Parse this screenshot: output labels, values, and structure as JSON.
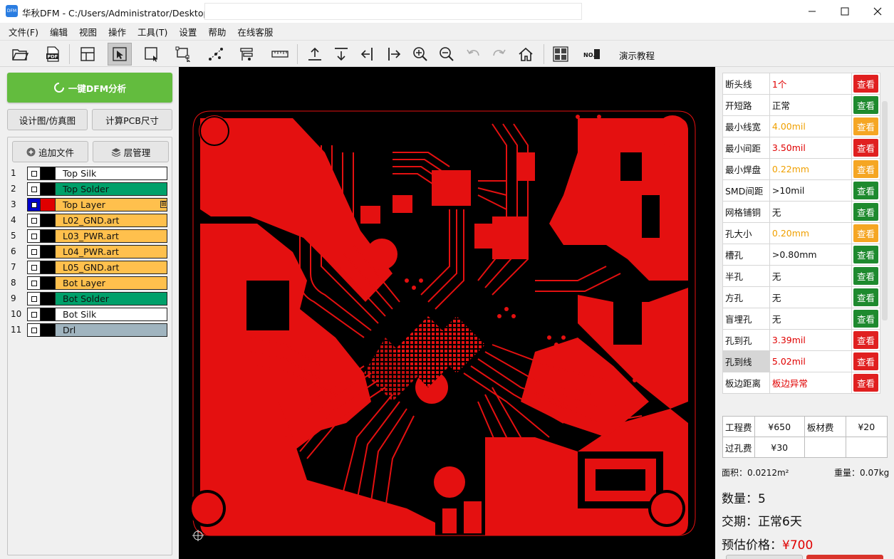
{
  "window": {
    "icon_text": "DFM",
    "title": "华秋DFM - C:/Users/Administrator/Desktop/(",
    "minimize_icon": "minimize-icon",
    "maximize_icon": "maximize-icon",
    "close_icon": "close-icon"
  },
  "menu": [
    "文件(F)",
    "编辑",
    "视图",
    "操作",
    "工具(T)",
    "设置",
    "帮助",
    "在线客服"
  ],
  "toolbar": {
    "icons": [
      "open-folder-icon",
      "pdf-icon",
      "window-icon",
      "select-pointer-icon",
      "select-box-icon",
      "net-select-icon",
      "route-icon",
      "align-icon",
      "ruler-icon",
      "export-up-icon",
      "import-down-icon",
      "align-left-icon",
      "align-right-icon",
      "zoom-in-icon",
      "zoom-out-icon",
      "undo-icon",
      "redo-icon",
      "home-icon",
      "panelize-icon",
      "no-serial-icon"
    ],
    "demo_label": "演示教程",
    "pdf_text": "PDF",
    "no_text": "NO."
  },
  "left": {
    "dfm_button": "一键DFM分析",
    "design_button": "设计图/仿真图",
    "pcb_size_button": "计算PCB尺寸",
    "add_file_button": "追加文件",
    "layer_mgmt_button": "层管理",
    "layers": [
      {
        "num": "1",
        "name": "Top Silk",
        "color": "#ffffff",
        "swatch": "#000000"
      },
      {
        "num": "2",
        "name": "Top Solder",
        "color": "#00a06a",
        "swatch": "#000000"
      },
      {
        "num": "3",
        "name": "Top Layer",
        "color": "#ffc04d",
        "swatch": "#e00000",
        "checked_color": "#0000cc",
        "expand": "⊞"
      },
      {
        "num": "4",
        "name": "L02_GND.art",
        "color": "#ffc04d",
        "swatch": "#000000"
      },
      {
        "num": "5",
        "name": "L03_PWR.art",
        "color": "#ffc04d",
        "swatch": "#000000"
      },
      {
        "num": "6",
        "name": "L04_PWR.art",
        "color": "#ffc04d",
        "swatch": "#000000"
      },
      {
        "num": "7",
        "name": "L05_GND.art",
        "color": "#ffc04d",
        "swatch": "#000000"
      },
      {
        "num": "8",
        "name": "Bot Layer",
        "color": "#ffc04d",
        "swatch": "#000000"
      },
      {
        "num": "9",
        "name": "Bot Solder",
        "color": "#00a06a",
        "swatch": "#000000"
      },
      {
        "num": "10",
        "name": "Bot Silk",
        "color": "#ffffff",
        "swatch": "#000000"
      },
      {
        "num": "11",
        "name": "Drl",
        "color": "#a0b4bf",
        "swatch": "#000000"
      }
    ]
  },
  "checks": [
    {
      "label": "断头线",
      "value": "1个",
      "value_color": "#e00000",
      "button": "查看",
      "button_color": "#e02020"
    },
    {
      "label": "开短路",
      "value": "正常",
      "value_color": "#111111",
      "button": "查看",
      "button_color": "#1e8a2e"
    },
    {
      "label": "最小线宽",
      "value": "4.00mil",
      "value_color": "#f0a000",
      "button": "查看",
      "button_color": "#f5a623"
    },
    {
      "label": "最小间距",
      "value": "3.50mil",
      "value_color": "#e00000",
      "button": "查看",
      "button_color": "#e02020"
    },
    {
      "label": "最小焊盘",
      "value": "0.22mm",
      "value_color": "#f0a000",
      "button": "查看",
      "button_color": "#f5a623"
    },
    {
      "label": "SMD间距",
      "value": ">10mil",
      "value_color": "#111111",
      "button": "查看",
      "button_color": "#1e8a2e"
    },
    {
      "label": "网格铺铜",
      "value": "无",
      "value_color": "#111111",
      "button": "查看",
      "button_color": "#1e8a2e"
    },
    {
      "label": "孔大小",
      "value": "0.20mm",
      "value_color": "#f0a000",
      "button": "查看",
      "button_color": "#f5a623"
    },
    {
      "label": "槽孔",
      "value": ">0.80mm",
      "value_color": "#111111",
      "button": "查看",
      "button_color": "#1e8a2e"
    },
    {
      "label": "半孔",
      "value": "无",
      "value_color": "#111111",
      "button": "查看",
      "button_color": "#1e8a2e"
    },
    {
      "label": "方孔",
      "value": "无",
      "value_color": "#111111",
      "button": "查看",
      "button_color": "#1e8a2e"
    },
    {
      "label": "盲埋孔",
      "value": "无",
      "value_color": "#111111",
      "button": "查看",
      "button_color": "#1e8a2e"
    },
    {
      "label": "孔到孔",
      "value": "3.39mil",
      "value_color": "#e00000",
      "button": "查看",
      "button_color": "#e02020"
    },
    {
      "label": "孔到线",
      "value": "5.02mil",
      "value_color": "#e00000",
      "button": "查看",
      "button_color": "#e02020",
      "highlight": true
    },
    {
      "label": "板边距离",
      "value": "板边异常",
      "value_color": "#e00000",
      "button": "查看",
      "button_color": "#e02020"
    }
  ],
  "fees": {
    "engineering_label": "工程费",
    "engineering_value": "¥650",
    "board_label": "板材费",
    "board_value": "¥20",
    "via_label": "过孔费",
    "via_value": "¥30"
  },
  "metrics": {
    "area": "面积：0.0212m²",
    "weight": "重量：0.07kg"
  },
  "summary": {
    "quantity": "数量：5",
    "delivery": "交期：正常6天",
    "price_label": "预估价格：",
    "price_value": "¥700"
  },
  "colors": {
    "accent_green": "#63bc3e",
    "copper_red": "#e41010",
    "price_red": "#e00000"
  }
}
